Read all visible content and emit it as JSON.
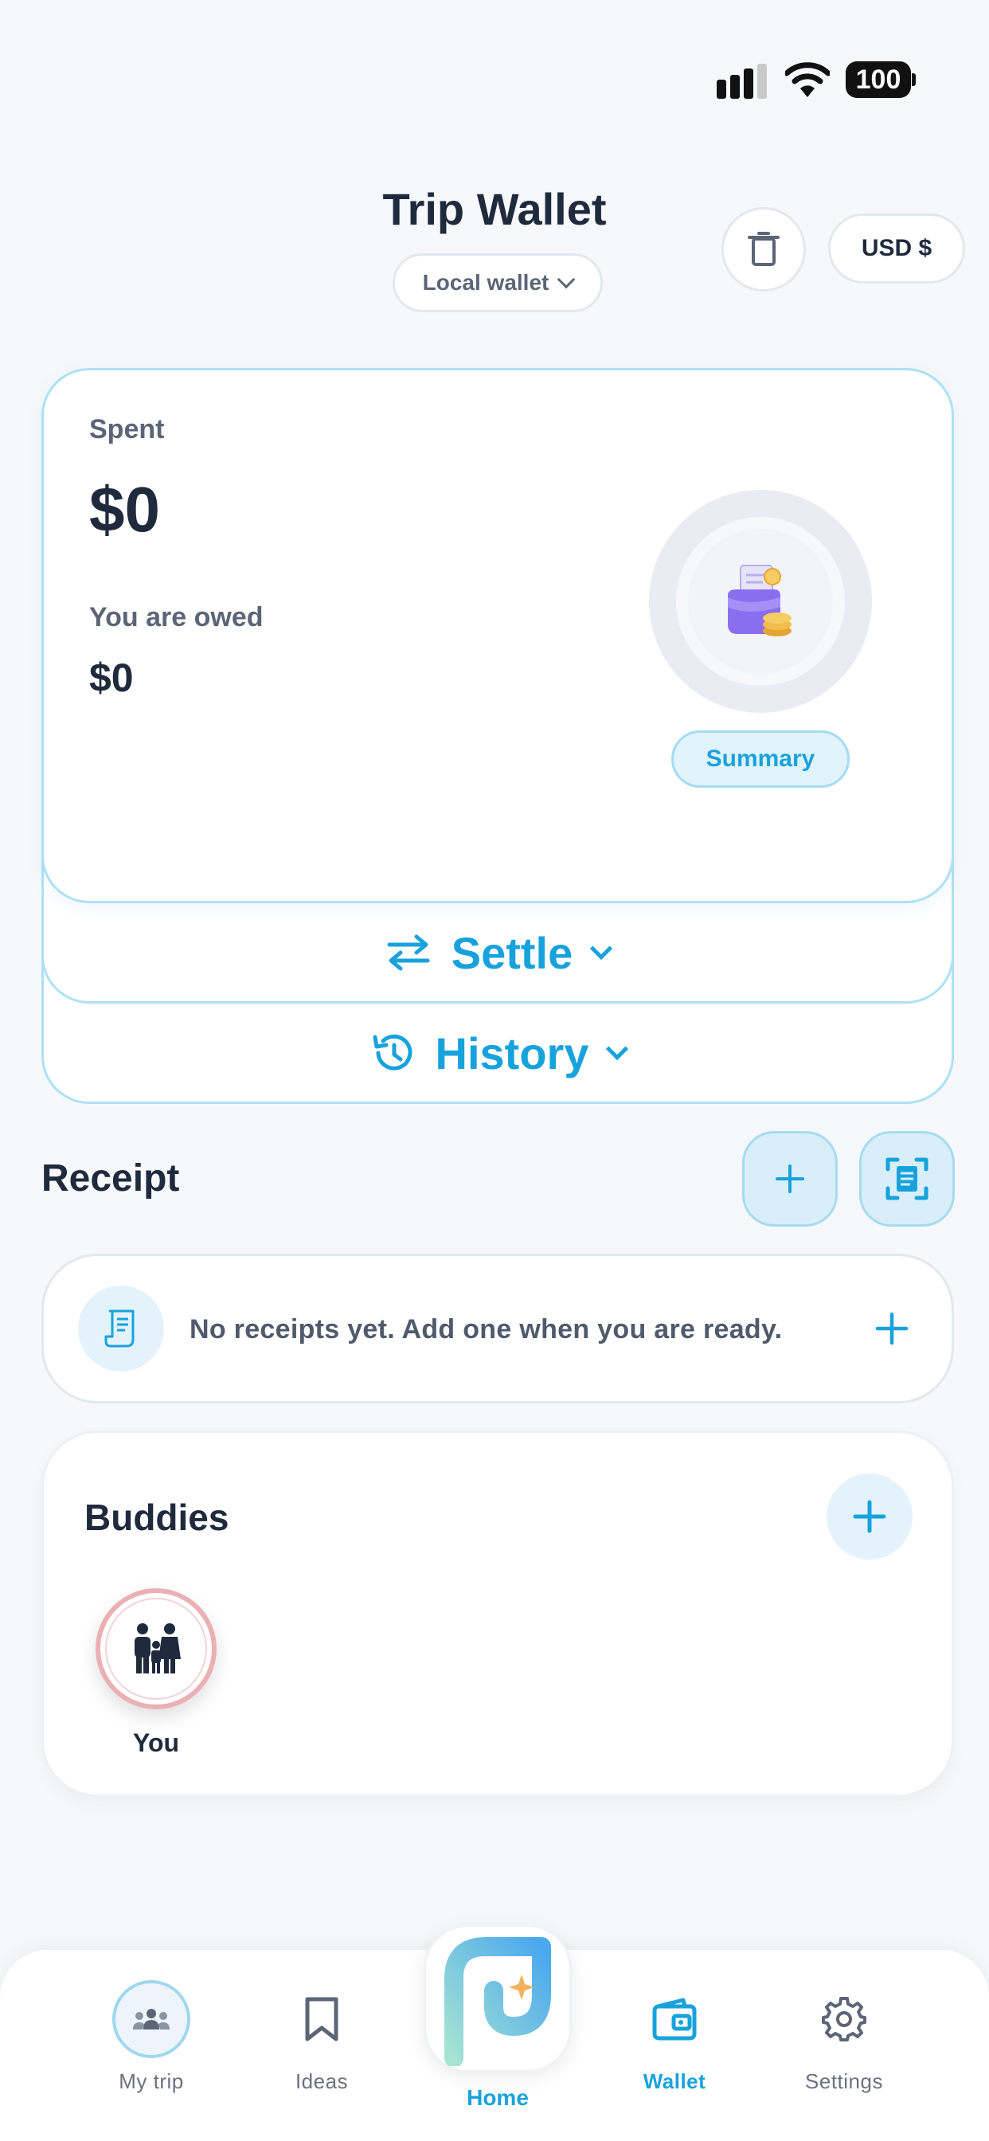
{
  "status_bar": {
    "battery": "100"
  },
  "header": {
    "title": "Trip Wallet",
    "wallet_selector": "Local wallet",
    "currency": "USD $"
  },
  "summary_card": {
    "spent_label": "Spent",
    "spent_value": "$0",
    "owed_label": "You are owed",
    "owed_value": "$0",
    "summary_button": "Summary"
  },
  "actions": {
    "settle": "Settle",
    "history": "History"
  },
  "receipt": {
    "title": "Receipt",
    "empty_message": "No receipts yet. Add one when you are ready."
  },
  "buddies": {
    "title": "Buddies",
    "members": [
      {
        "name": "You"
      }
    ]
  },
  "bottom_nav": {
    "items": [
      {
        "label": "My trip",
        "icon": "group-icon"
      },
      {
        "label": "Ideas",
        "icon": "bookmark-icon"
      },
      {
        "label": "Home",
        "icon": "home-logo-icon"
      },
      {
        "label": "Wallet",
        "icon": "wallet-icon"
      },
      {
        "label": "Settings",
        "icon": "gear-icon"
      }
    ],
    "active": "Wallet"
  },
  "colors": {
    "accent": "#18a2dc",
    "text_dark": "#1f2a3c",
    "text_muted": "#5b6576",
    "card_border": "#aee0f5"
  }
}
